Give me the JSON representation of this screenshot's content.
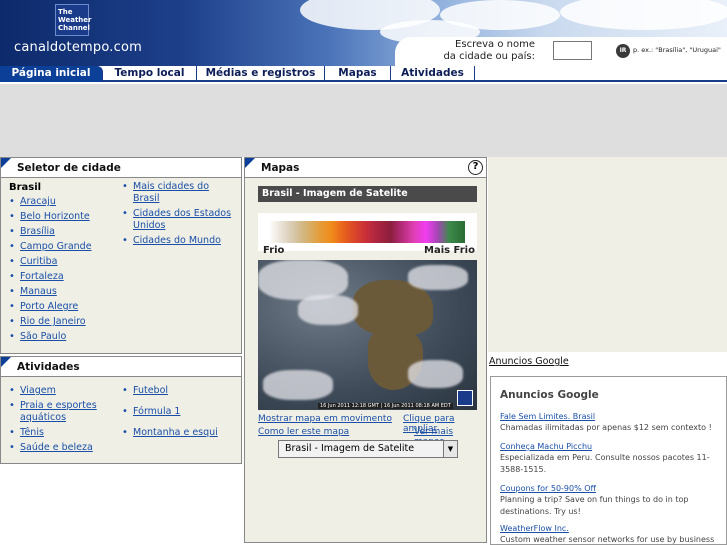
{
  "header": {
    "logo_lines": [
      "The",
      "Weather",
      "Channel"
    ],
    "site_name": "canaldotempo.com",
    "search_prompt_line1": "Escreva o nome",
    "search_prompt_line2": "da cidade ou país:",
    "search_value": "",
    "go_label": "IR",
    "search_hint": "p. ex.: \"Brasília\", \"Uruguai\""
  },
  "nav": {
    "tabs": [
      {
        "label": "Página inicial",
        "active": true
      },
      {
        "label": "Tempo local",
        "active": false
      },
      {
        "label": "Médias e registros",
        "active": false
      },
      {
        "label": "Mapas",
        "active": false
      },
      {
        "label": "Atividades",
        "active": false
      }
    ]
  },
  "city_selector": {
    "title": "Seletor de cidade",
    "country": "Brasil",
    "cities": [
      "Aracaju",
      "Belo Horizonte",
      "Brasília",
      "Campo Grande",
      "Curitiba",
      "Fortaleza",
      "Manaus",
      "Porto Alegre",
      "Rio de Janeiro",
      "São Paulo"
    ],
    "more_links": [
      "Mais cidades do Brasil",
      "Cidades dos Estados Unidos",
      "Cidades do Mundo"
    ]
  },
  "activities": {
    "title": "Atividades",
    "col1": [
      "Viagem",
      "Praia e esportes aquáticos",
      "Tênis",
      "Saúde e beleza"
    ],
    "col2": [
      "Futebol",
      "Fórmula 1",
      "Montanha e esqui"
    ]
  },
  "maps": {
    "title": "Mapas",
    "help_label": "?",
    "subtitle": "Brasil - Imagem de Satelite",
    "legend_low": "Frio",
    "legend_high": "Mais Frio",
    "timestamp": "16 Jun 2011 12:18 GMT | 16 Jun 2011 08:18 AM EDT",
    "link_animate": "Mostrar mapa em movimento",
    "link_enlarge": "Clique para ampliar",
    "link_howto": "Como ler este mapa",
    "link_more": "Ver mais mapas",
    "select_value": "Brasil - Imagem de Satelite",
    "select_arrow": "▼"
  },
  "ads": {
    "link_label": "Anuncios Google",
    "title": "Anuncios Google",
    "items": [
      {
        "title": "Fale Sem Limites. Brasil",
        "desc": "Chamadas ilimitadas por apenas $12 sem contexto !"
      },
      {
        "title": "Conheça Machu Picchu",
        "desc": "Especializada em Peru. Consulte nossos pacotes 11-3588-1515."
      },
      {
        "title": "Coupons for 50-90% Off",
        "desc": "Planning a trip? Save on fun things to do in top destinations. Try us!"
      },
      {
        "title": "WeatherFlow Inc.",
        "desc": "Custom weather sensor networks for use by business and"
      }
    ]
  },
  "colors": {
    "brand_blue": "#0c3f98",
    "link_blue": "#1a4fa8",
    "panel_bg": "#efefe5"
  }
}
